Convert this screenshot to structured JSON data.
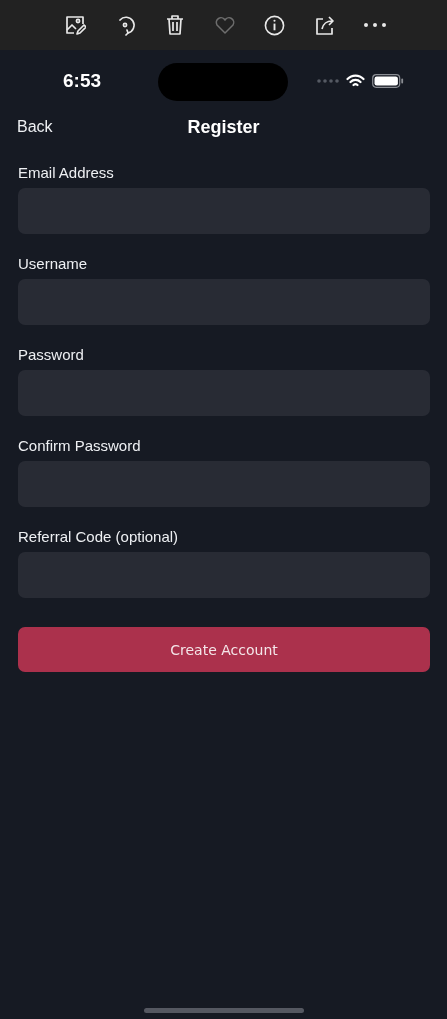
{
  "toolbar": [
    {
      "kind": "edit-image",
      "disabled": false
    },
    {
      "kind": "rotate",
      "disabled": false
    },
    {
      "kind": "trash",
      "disabled": false
    },
    {
      "kind": "heart",
      "disabled": true
    },
    {
      "kind": "info",
      "disabled": false
    },
    {
      "kind": "share",
      "disabled": false
    },
    {
      "kind": "more",
      "disabled": false
    }
  ],
  "status_bar": {
    "time": "6:53"
  },
  "nav": {
    "back": "Back",
    "title": "Register"
  },
  "fields": [
    {
      "label": "Email Address"
    },
    {
      "label": "Username"
    },
    {
      "label": "Password"
    },
    {
      "label": "Confirm Password"
    },
    {
      "label": "Referral Code (optional)"
    }
  ],
  "submit": "Create Account"
}
